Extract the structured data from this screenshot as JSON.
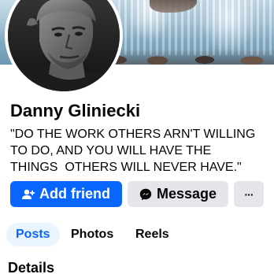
{
  "profile": {
    "name": "Danny Gliniecki",
    "bio_lines": [
      "\"DO THE WORK OTHERS ARN'T WILLING",
      "TO DO, AND YOU WILL HAVE THE",
      "THINGS  OTHERS WILL NEVER HAVE.\""
    ]
  },
  "actions": {
    "add_friend": "Add friend",
    "message": "Message",
    "more": "···"
  },
  "tabs": [
    {
      "label": "Posts",
      "active": true
    },
    {
      "label": "Photos",
      "active": false
    },
    {
      "label": "Reels",
      "active": false
    }
  ],
  "sections": {
    "details_title": "Details"
  },
  "colors": {
    "primary": "#0866ff",
    "secondary_button": "#e4e6eb",
    "active_tab_bg": "#ebf5ff",
    "text": "#050505"
  },
  "icons": {
    "add_friend": "person-plus-icon",
    "message": "messenger-icon",
    "more": "more-icon"
  }
}
